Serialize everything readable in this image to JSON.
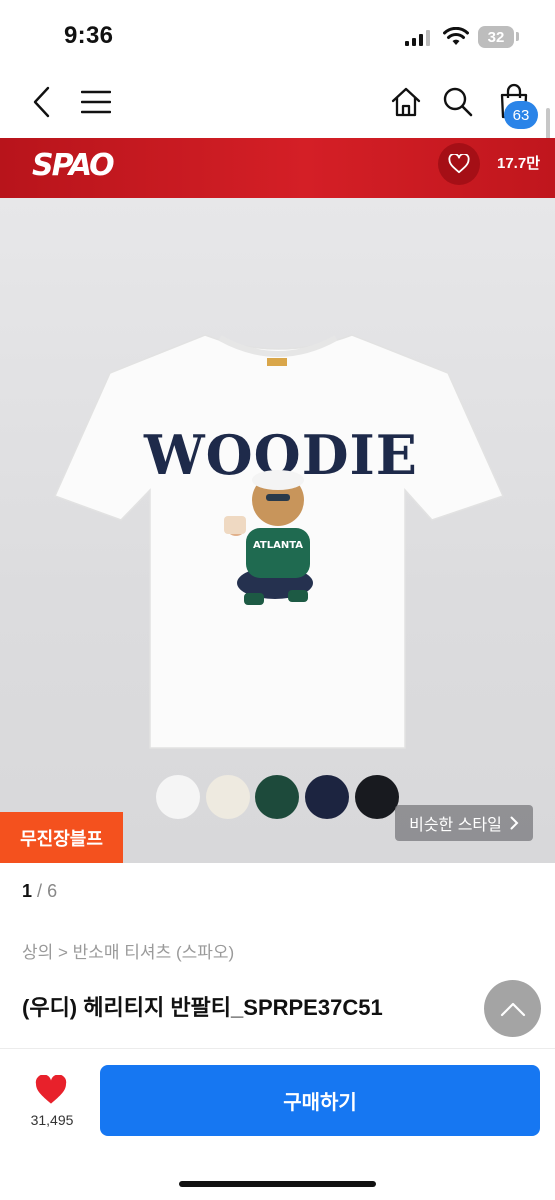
{
  "status_bar": {
    "time": "9:36",
    "battery": "32"
  },
  "nav": {
    "cart_count": "63"
  },
  "brand": {
    "name": "SPAO",
    "likes": "17.7만"
  },
  "product_image": {
    "print_text": "WOODIE",
    "shirt_sub_text": "ATLANTA",
    "swatches": [
      {
        "name": "white",
        "color": "#f5f5f5"
      },
      {
        "name": "ivory",
        "color": "#eeeae0"
      },
      {
        "name": "green",
        "color": "#1d4a3b"
      },
      {
        "name": "navy",
        "color": "#1c2440"
      },
      {
        "name": "black",
        "color": "#181a1f"
      }
    ],
    "badge": "무진장블프",
    "similar_style": "비슷한 스타일"
  },
  "gallery": {
    "current": "1",
    "total": "6",
    "separator": "/"
  },
  "breadcrumb": "상의 > 반소매 티셔츠 (스파오)",
  "product_title": "(우디) 헤리티지 반팔티_SPRPE37C51",
  "bottom_bar": {
    "wish_count": "31,495",
    "buy_label": "구매하기"
  },
  "colors": {
    "brand_red": "#d41f26",
    "accent_blue": "#1677f2",
    "badge_orange": "#f4511e",
    "heart_red": "#e8212b"
  }
}
